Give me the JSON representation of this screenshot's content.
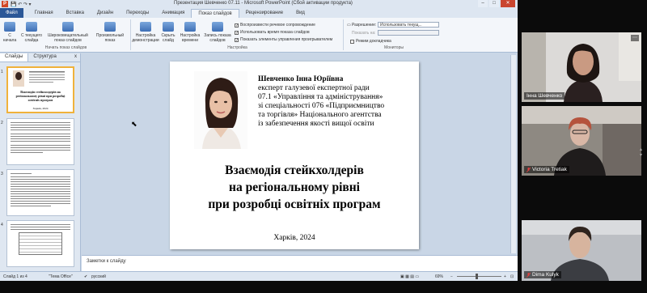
{
  "window": {
    "app_letter": "P",
    "title": "Презентация Шевченко 07.11  -  Microsoft PowerPoint (Сбой активации продукта)",
    "min": "–",
    "max": "□",
    "close": "✕"
  },
  "tabs": {
    "file": "Файл",
    "items": [
      "Главная",
      "Вставка",
      "Дизайн",
      "Переходы",
      "Анимация",
      "Показ слайдов",
      "Рецензирование",
      "Вид"
    ],
    "active_index": 5
  },
  "ribbon": {
    "group_start": {
      "label": "Начать показ слайдов",
      "buttons": [
        "С начала",
        "С текущего слайда",
        "Широковещательный показ слайдов",
        "Произвольный показ"
      ]
    },
    "group_setup": {
      "label": "Настройка",
      "buttons": [
        "Настройка демонстрации",
        "Скрыть слайд",
        "Настройка времени",
        "Запись показа слайдов"
      ],
      "checks": [
        {
          "label": "Воспроизвести речевое сопровождение",
          "checked": true
        },
        {
          "label": "Использовать время показа слайдов",
          "checked": true
        },
        {
          "label": "Показать элементы управления проигрывателем",
          "checked": true
        }
      ]
    },
    "group_monitors": {
      "label": "Мониторы",
      "resolution_label": "Разрешение:",
      "resolution_value": "Использовать текущ...",
      "show_on_label": "Показать на:",
      "presenter_view": "Режим докладчика"
    }
  },
  "left_panel": {
    "tabs": [
      "Слайды",
      "Структура"
    ],
    "close": "x",
    "thumbs": [
      {
        "num": "1",
        "title": "Взаємодія стейкхолдерів на регіональному рівні при розробці освітніх програм",
        "city": "Харків, 2024"
      },
      {
        "num": "2"
      },
      {
        "num": "3"
      },
      {
        "num": "4"
      }
    ]
  },
  "slide": {
    "author_name": "Шевченко Інна Юріївна",
    "author_lines": [
      "експерт галузевої експертної ради",
      "07.1 «Управління та адміністрування»",
      "зі спеціальності 076 «Підприємництво",
      "та торгівля» Національного агентства",
      "із забезпечення якості вищої освіти"
    ],
    "title_lines": [
      "Взаємодія стейкхолдерів",
      "на регіональному рівні",
      "при розробці освітніх програм"
    ],
    "city": "Харків, 2024"
  },
  "notes": {
    "placeholder": "Заметки к слайду"
  },
  "status": {
    "slide": "Слайд 1 из 4",
    "theme": "\"Тема Office\"",
    "lang": "русский",
    "zoom": "69%"
  },
  "participants": [
    {
      "name": "Інна Шевченко",
      "muted": false
    },
    {
      "name": "Victoria Tretiak",
      "muted": true
    },
    {
      "name": "Dima Kulyk",
      "muted": true
    }
  ],
  "colors": {
    "file_tab": "#2b5797",
    "ribbon_bg": "#f3f6fa",
    "workspace": "#c9d6e6",
    "muted_mic": "#e04040"
  }
}
